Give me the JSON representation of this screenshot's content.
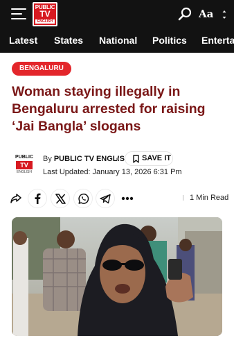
{
  "header": {
    "logo": {
      "line1": "PUBLIC",
      "line2": "TV",
      "line3": "ENGLISH"
    },
    "font_size_label": "Aa",
    "icons": {
      "menu": "hamburger-icon",
      "search": "search-icon",
      "font": "font-size-icon"
    }
  },
  "nav": {
    "items": [
      "Latest",
      "States",
      "National",
      "Politics",
      "Entertai"
    ]
  },
  "article": {
    "category": "BENGALURU",
    "headline": "Woman staying illegally in Bengaluru arrested for raising ‘Jai Bangla’ slogans",
    "by_prefix": "By",
    "author": "PUBLIC TV ENGLISH",
    "save_label": "SAVE IT",
    "updated": "Last Updated: January 13, 2026 6:31 Pm",
    "read_time": "1 Min Read",
    "publisher_logo": {
      "top": "PUBLIC",
      "mid": "TV",
      "bottom": "ENGLISH"
    }
  },
  "share": {
    "icons": [
      "share-icon",
      "facebook-icon",
      "x-icon",
      "whatsapp-icon",
      "telegram-icon",
      "more-icon"
    ]
  },
  "colors": {
    "bar_bg": "#121212",
    "brand_red": "#e3262b",
    "headline": "#7a1717"
  }
}
